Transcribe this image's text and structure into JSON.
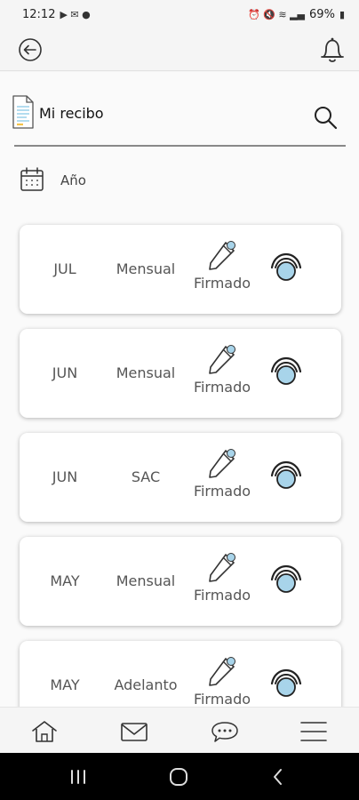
{
  "status_bar": {
    "time": "12:12",
    "battery": "69%"
  },
  "header": {
    "title": "Mi recibo"
  },
  "filters": {
    "year_label": "Año"
  },
  "receipts": [
    {
      "month": "JUL",
      "type": "Mensual",
      "status": "Firmado"
    },
    {
      "month": "JUN",
      "type": "Mensual",
      "status": "Firmado"
    },
    {
      "month": "JUN",
      "type": "SAC",
      "status": "Firmado"
    },
    {
      "month": "MAY",
      "type": "Mensual",
      "status": "Firmado"
    },
    {
      "month": "MAY",
      "type": "Adelanto",
      "status": "Firmado"
    }
  ],
  "colors": {
    "accent": "#a8d4ea",
    "icon_stroke": "#333333"
  },
  "icons": {
    "back": "back-arrow-icon",
    "notifications": "bell-icon",
    "document": "document-icon",
    "search": "search-icon",
    "calendar": "calendar-icon",
    "sign": "pen-sign-icon",
    "view": "eye-icon",
    "home": "home-icon",
    "mail": "mail-icon",
    "chat": "chat-icon",
    "menu": "menu-icon"
  }
}
